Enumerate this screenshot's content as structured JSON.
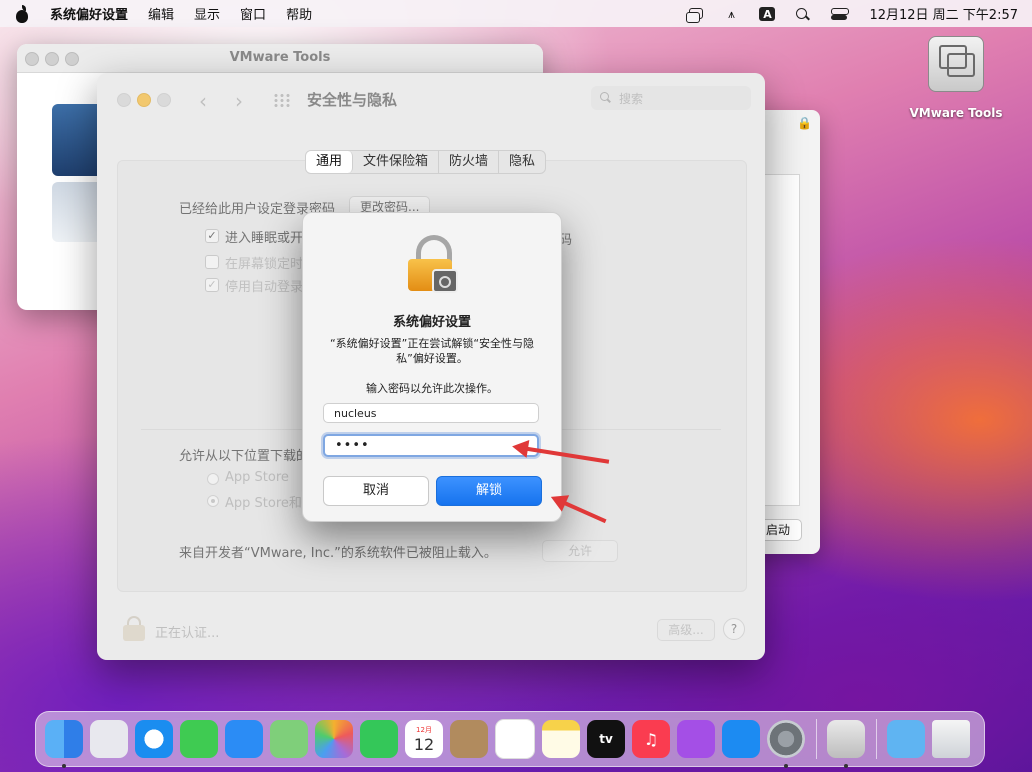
{
  "menubar": {
    "app_name": "系统偏好设置",
    "menus": [
      "编辑",
      "显示",
      "窗口",
      "帮助"
    ],
    "keyboard_indicator": "A",
    "clock": "12月12日 周二 下午2:57"
  },
  "desktop": {
    "icon_label": "VMware Tools"
  },
  "vmware_window": {
    "title": "VMware Tools"
  },
  "side_window": {
    "button_label": "启动"
  },
  "security_window": {
    "title": "安全性与隐私",
    "search_placeholder": "搜索",
    "tabs": [
      "通用",
      "文件保险箱",
      "防火墙",
      "隐私"
    ],
    "active_tab": "通用",
    "password_set_text": "已经给此用户设定登录密码",
    "change_password_button": "更改密码...",
    "checkbox_sleep": "进入睡眠或开",
    "checkbox_sleep_tail": "码",
    "checkbox_lock": "在屏幕锁定时",
    "checkbox_autologin": "停用自动登录",
    "allow_download_label": "允许从以下位置下载的",
    "radio_app_store": "App Store",
    "radio_app_store_and": "App Store和",
    "blocked_text": "来自开发者“VMware, Inc.”的系统软件已被阻止载入。",
    "allow_button": "允许",
    "auth_status": "正在认证...",
    "advanced_button": "高级...",
    "help_button": "?"
  },
  "auth_dialog": {
    "title": "系统偏好设置",
    "message": "“系统偏好设置”正在尝试解锁“安全性与隐私”偏好设置。",
    "prompt": "输入密码以允许此次操作。",
    "username_value": "nucleus",
    "password_value": "••••",
    "cancel_label": "取消",
    "unlock_label": "解锁"
  },
  "dock": {
    "calendar_month": "12月",
    "calendar_day": "12",
    "tv_label": "tv",
    "items": [
      "finder-icon",
      "launchpad-icon",
      "safari-icon",
      "messages-icon",
      "mail-icon",
      "maps-icon",
      "photos-icon",
      "facetime-icon",
      "calendar-icon",
      "contacts-icon",
      "reminders-icon",
      "notes-icon",
      "tv-icon",
      "music-icon",
      "podcasts-icon",
      "app-store-icon",
      "system-preferences-icon",
      "installer-icon",
      "downloads-icon",
      "trash-icon"
    ]
  },
  "colors": {
    "accent_blue": "#1673ee",
    "annotation_red": "#e03838",
    "traffic_yellow": "#f6b52c"
  }
}
